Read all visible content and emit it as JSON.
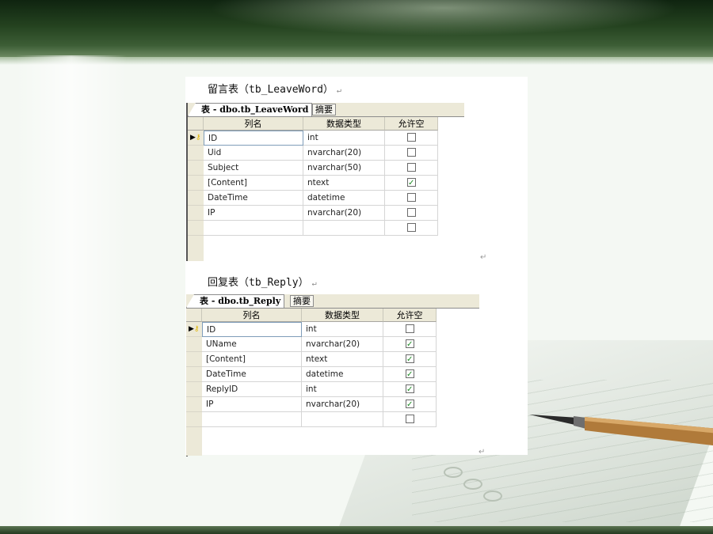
{
  "leaveword": {
    "caption": "留言表（tb_LeaveWord）",
    "tab_title": "表 - dbo.tb_LeaveWord",
    "tab_summary": "摘要",
    "headers": [
      "列名",
      "数据类型",
      "允许空"
    ],
    "rows": [
      {
        "name": "ID",
        "type": "int",
        "nullable": false,
        "key": true
      },
      {
        "name": "Uid",
        "type": "nvarchar(20)",
        "nullable": false
      },
      {
        "name": "Subject",
        "type": "nvarchar(50)",
        "nullable": false
      },
      {
        "name": "[Content]",
        "type": "ntext",
        "nullable": true
      },
      {
        "name": "DateTime",
        "type": "datetime",
        "nullable": false
      },
      {
        "name": "IP",
        "type": "nvarchar(20)",
        "nullable": false
      },
      {
        "name": "",
        "type": "",
        "nullable": false
      }
    ]
  },
  "reply": {
    "caption": "回复表（tb_Reply）",
    "tab_title": "表 - dbo.tb_Reply",
    "tab_summary": "摘要",
    "headers": [
      "列名",
      "数据类型",
      "允许空"
    ],
    "rows": [
      {
        "name": "ID",
        "type": "int",
        "nullable": false,
        "key": true
      },
      {
        "name": "UName",
        "type": "nvarchar(20)",
        "nullable": true
      },
      {
        "name": "[Content]",
        "type": "ntext",
        "nullable": true
      },
      {
        "name": "DateTime",
        "type": "datetime",
        "nullable": true
      },
      {
        "name": "ReplyID",
        "type": "int",
        "nullable": true
      },
      {
        "name": "IP",
        "type": "nvarchar(20)",
        "nullable": true
      },
      {
        "name": "",
        "type": "",
        "nullable": false
      }
    ]
  },
  "marks": {
    "return": "↵"
  },
  "icons": {
    "row_indicator": "row-arrow-icon",
    "primary_key": "key-icon",
    "check": "checkbox-icon"
  },
  "colors": {
    "header_bg": "#ece9d8",
    "check_green": "#1c8a22",
    "slide_dark": "#24421f"
  }
}
